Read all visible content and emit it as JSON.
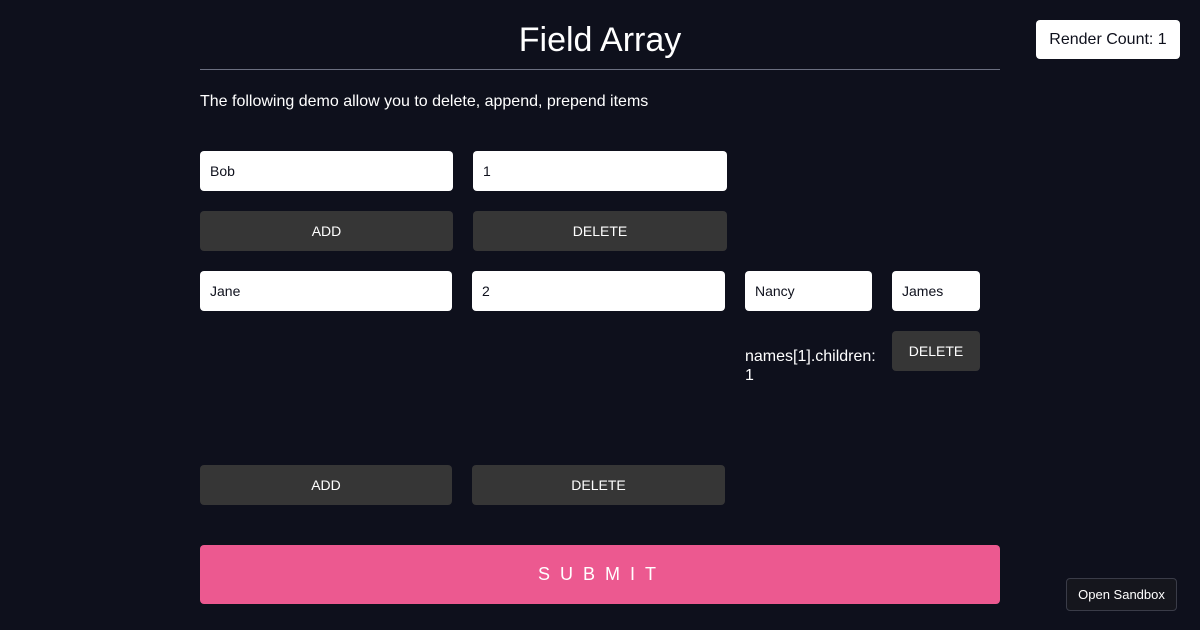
{
  "header": {
    "title": "Field Array",
    "render_count": "Render Count: 1"
  },
  "description": "The following demo allow you to delete, append, prepend items",
  "rows": [
    {
      "name_value": "Bob",
      "number_value": "1",
      "add_label": "ADD",
      "delete_label": "DELETE"
    },
    {
      "name_value": "Jane",
      "number_value": "2",
      "children": [
        {
          "value": "Nancy"
        },
        {
          "value": "James"
        }
      ],
      "children_label": "names[1].children: 1",
      "child_delete_label": "DELETE",
      "add_label": "ADD",
      "delete_label": "DELETE"
    }
  ],
  "submit_label": "SUBMIT",
  "sandbox_label": "Open Sandbox",
  "colors": {
    "background": "#0e101c",
    "submit": "#ec5990",
    "button": "#363636",
    "input": "#ffffff"
  }
}
